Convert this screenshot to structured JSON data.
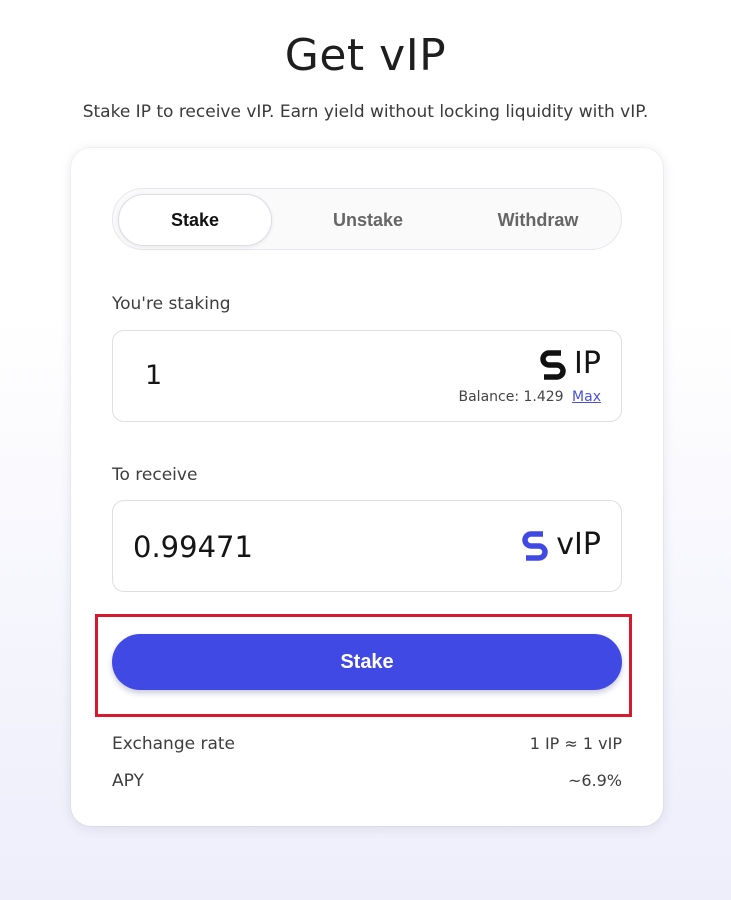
{
  "header": {
    "title": "Get vIP",
    "subtitle": "Stake IP to receive vIP. Earn yield without locking liquidity with vIP."
  },
  "tabs": [
    {
      "label": "Stake",
      "active": true
    },
    {
      "label": "Unstake",
      "active": false
    },
    {
      "label": "Withdraw",
      "active": false
    }
  ],
  "stake_input": {
    "label": "You're staking",
    "value": "1",
    "token": "IP",
    "token_icon": "story-ip-logo-icon",
    "balance_label": "Balance: 1.429",
    "max_label": "Max"
  },
  "receive_input": {
    "label": "To receive",
    "value": "0.99471",
    "token": "vIP",
    "token_icon": "vip-logo-icon"
  },
  "action": {
    "button_label": "Stake",
    "button_color": "#4149e5"
  },
  "info": {
    "exchange_rate_label": "Exchange rate",
    "exchange_rate_value": "1 IP ≈ 1 vIP",
    "apy_label": "APY",
    "apy_value": "~6.9%"
  },
  "colors": {
    "accent": "#4149e5",
    "highlight_frame": "#d7192d",
    "ip_icon": "#111111",
    "vip_icon": "#4149e5"
  }
}
